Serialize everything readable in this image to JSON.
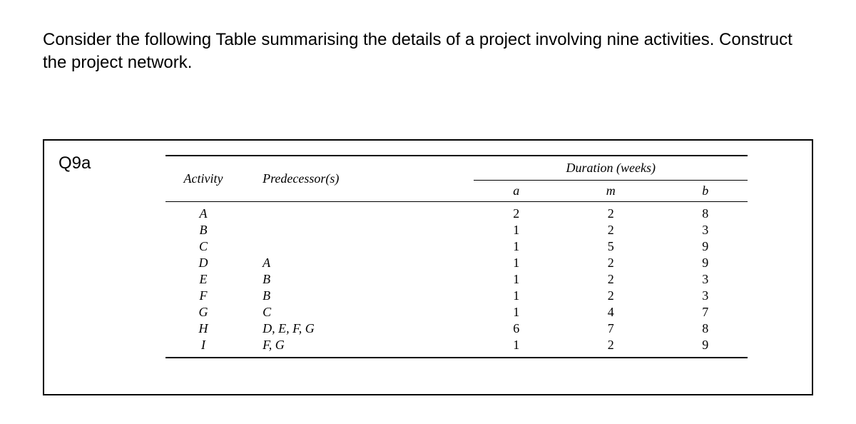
{
  "intro": "Consider the following Table summarising the details of a project involving nine activities. Construct the project network.",
  "question_label": "Q9a",
  "headers": {
    "activity": "Activity",
    "predecessor": "Predecessor(s)",
    "duration": "Duration (weeks)",
    "a": "a",
    "m": "m",
    "b": "b"
  },
  "rows": [
    {
      "activity": "A",
      "predecessor": "",
      "a": "2",
      "m": "2",
      "b": "8"
    },
    {
      "activity": "B",
      "predecessor": "",
      "a": "1",
      "m": "2",
      "b": "3"
    },
    {
      "activity": "C",
      "predecessor": "",
      "a": "1",
      "m": "5",
      "b": "9"
    },
    {
      "activity": "D",
      "predecessor": "A",
      "a": "1",
      "m": "2",
      "b": "9"
    },
    {
      "activity": "E",
      "predecessor": "B",
      "a": "1",
      "m": "2",
      "b": "3"
    },
    {
      "activity": "F",
      "predecessor": "B",
      "a": "1",
      "m": "2",
      "b": "3"
    },
    {
      "activity": "G",
      "predecessor": "C",
      "a": "1",
      "m": "4",
      "b": "7"
    },
    {
      "activity": "H",
      "predecessor": "D, E, F, G",
      "a": "6",
      "m": "7",
      "b": "8"
    },
    {
      "activity": "I",
      "predecessor": "F, G",
      "a": "1",
      "m": "2",
      "b": "9"
    }
  ]
}
